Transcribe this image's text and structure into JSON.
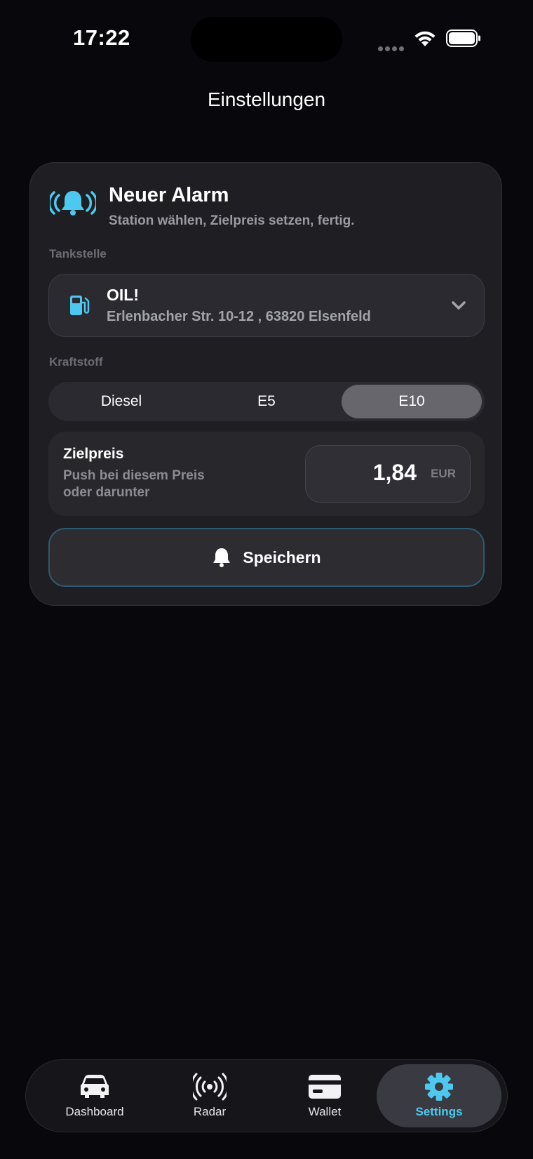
{
  "status_bar": {
    "time": "17:22"
  },
  "nav": {
    "title": "Einstellungen"
  },
  "card": {
    "title": "Neuer Alarm",
    "subtitle": "Station wählen, Zielpreis setzen, fertig.",
    "station_section_label": "Tankstelle",
    "station": {
      "name": "OIL!",
      "address": "Erlenbacher Str. 10-12 , 63820 Elsenfeld"
    },
    "fuel_section_label": "Kraftstoff",
    "fuel_options": [
      "Diesel",
      "E5",
      "E10"
    ],
    "fuel_selected": "E10",
    "target": {
      "title": "Zielpreis",
      "description": "Push bei diesem Preis oder darunter",
      "value": "1,84",
      "unit": "EUR"
    },
    "save_label": "Speichern"
  },
  "tabbar": {
    "tabs": [
      {
        "label": "Dashboard",
        "icon": "car-icon"
      },
      {
        "label": "Radar",
        "icon": "radar-icon"
      },
      {
        "label": "Wallet",
        "icon": "wallet-icon"
      },
      {
        "label": "Settings",
        "icon": "gear-icon"
      }
    ],
    "active": "Settings"
  },
  "colors": {
    "accent": "#4dc9f0",
    "background": "#07070c",
    "card": "#1f1f23"
  }
}
